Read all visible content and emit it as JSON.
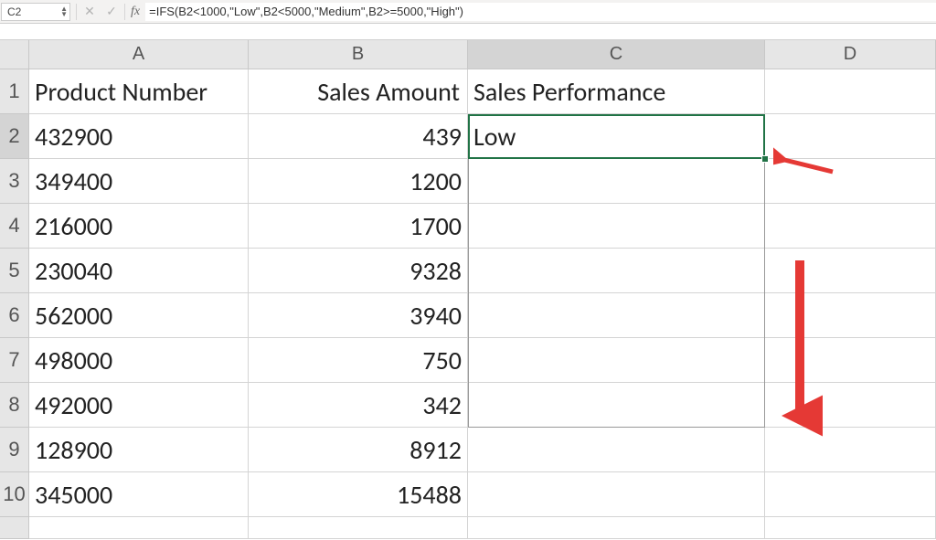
{
  "name_box": "C2",
  "formula": "=IFS(B2<1000,\"Low\",B2<5000,\"Medium\",B2>=5000,\"High\")",
  "columns": [
    "A",
    "B",
    "C",
    "D"
  ],
  "rows": [
    "1",
    "2",
    "3",
    "4",
    "5",
    "6",
    "7",
    "8",
    "9",
    "10"
  ],
  "headers": {
    "A": "Product Number",
    "B": "Sales Amount",
    "C": "Sales Performance"
  },
  "table": [
    {
      "a": "432900",
      "b": "439",
      "c": "Low"
    },
    {
      "a": "349400",
      "b": "1200",
      "c": ""
    },
    {
      "a": "216000",
      "b": "1700",
      "c": ""
    },
    {
      "a": "230040",
      "b": "9328",
      "c": ""
    },
    {
      "a": "562000",
      "b": "3940",
      "c": ""
    },
    {
      "a": "498000",
      "b": "750",
      "c": ""
    },
    {
      "a": "492000",
      "b": "342",
      "c": ""
    },
    {
      "a": "128900",
      "b": "8912",
      "c": ""
    },
    {
      "a": "345000",
      "b": "15488",
      "c": ""
    }
  ],
  "chart_data": {
    "type": "table",
    "title": "Sales Performance classification via IFS",
    "columns": [
      "Product Number",
      "Sales Amount",
      "Sales Performance"
    ],
    "rows": [
      [
        "432900",
        439,
        "Low"
      ],
      [
        "349400",
        1200,
        null
      ],
      [
        "216000",
        1700,
        null
      ],
      [
        "230040",
        9328,
        null
      ],
      [
        "562000",
        3940,
        null
      ],
      [
        "498000",
        750,
        null
      ],
      [
        "492000",
        342,
        null
      ],
      [
        "128900",
        8912,
        null
      ],
      [
        "345000",
        15488,
        null
      ]
    ],
    "formula": "=IFS(B2<1000,\"Low\",B2<5000,\"Medium\",B2>=5000,\"High\")"
  }
}
